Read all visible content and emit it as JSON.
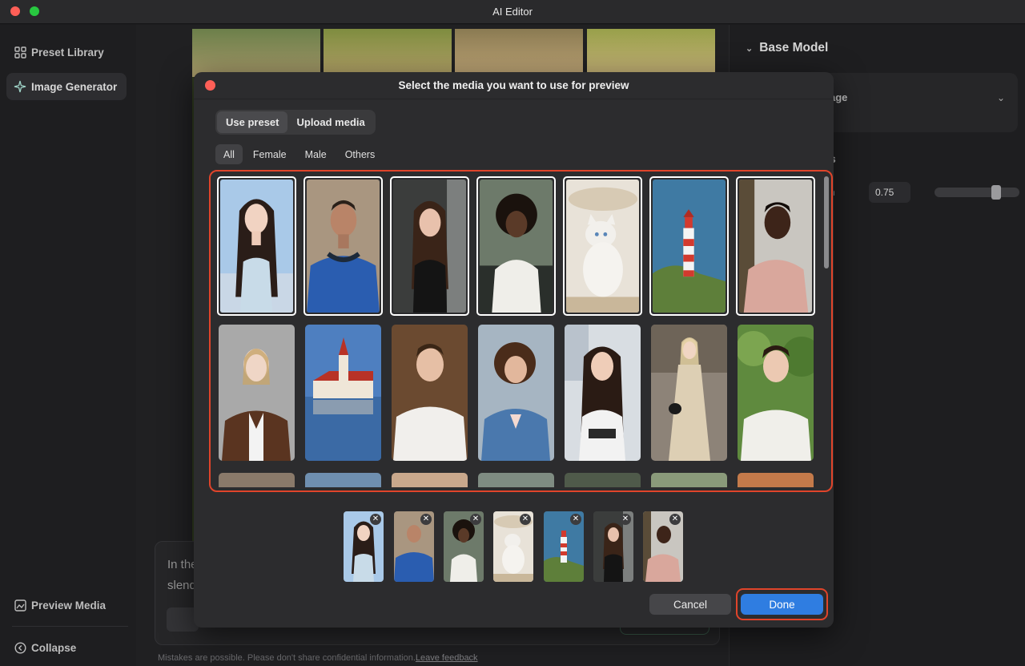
{
  "window": {
    "title": "AI Editor"
  },
  "sidebar": {
    "items": [
      {
        "label": "Preset Library",
        "icon": "grid-icon"
      },
      {
        "label": "Image Generator",
        "icon": "sparkle-icon",
        "active": true
      }
    ],
    "bottom": [
      {
        "label": "Preview Media",
        "icon": "preview-icon"
      },
      {
        "label": "Collapse",
        "icon": "collapse-icon"
      }
    ]
  },
  "background": {
    "chat_lines": [
      "In the",
      "slend"
    ],
    "footer_note": "Mistakes are possible. Please don't share confidential information.",
    "footer_link": "Leave feedback"
  },
  "right_panel": {
    "section_title": "Base Model",
    "card_text": "age",
    "section2_title": "s",
    "param_label": "h",
    "param_value": "0.75",
    "slider_fraction": 0.75
  },
  "modal": {
    "title": "Select the media you want to use for preview",
    "segments": [
      {
        "label": "Use preset",
        "active": true
      },
      {
        "label": "Upload media",
        "active": false
      }
    ],
    "filters": [
      {
        "label": "All",
        "active": true
      },
      {
        "label": "Female",
        "active": false
      },
      {
        "label": "Male",
        "active": false
      },
      {
        "label": "Others",
        "active": false
      }
    ],
    "cancel_label": "Cancel",
    "done_label": "Done",
    "remove_glyph": "✕",
    "selected_count": 7
  },
  "colors": {
    "accent": "#2f7de1",
    "highlight": "#e0442a",
    "modal_bg": "#2c2c2e"
  }
}
